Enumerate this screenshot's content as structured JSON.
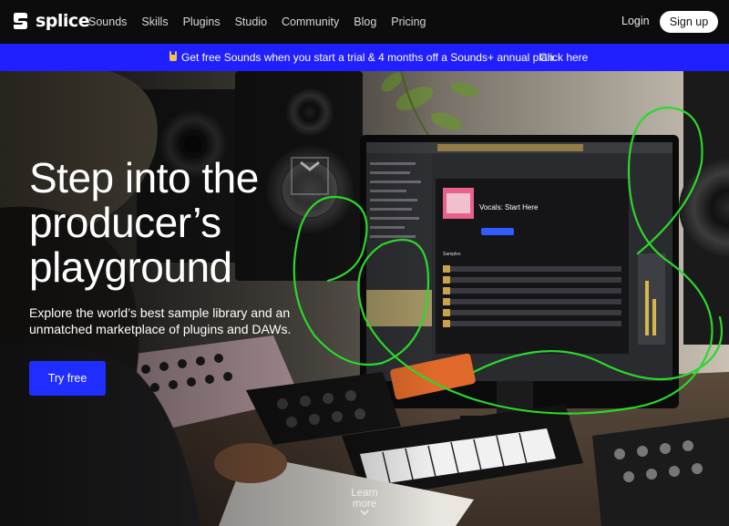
{
  "nav": {
    "brand": "splice",
    "links": [
      "Sounds",
      "Skills",
      "Plugins",
      "Studio",
      "Community",
      "Blog",
      "Pricing"
    ],
    "login_label": "Login",
    "signup_label": "Sign up"
  },
  "promo": {
    "text": "Get free Sounds when you start a trial & 4 months off a Sounds+ annual plan.",
    "link_label": "Click here"
  },
  "hero": {
    "headline": "Step into the producer’s playground",
    "subhead": "Explore the world’s best sample library and an unmatched marketplace of plugins and DAWs.",
    "cta_label": "Try free",
    "learn_more_label": "Learn more",
    "screen": {
      "pack_title": "Vocals: Start Here",
      "samples_heading": "Samples"
    }
  },
  "colors": {
    "nav_bg": "#0c0c0c",
    "promo_bg": "#1f1fff",
    "cta_bg": "#1f2eff",
    "accent_green": "#2bd82b"
  }
}
